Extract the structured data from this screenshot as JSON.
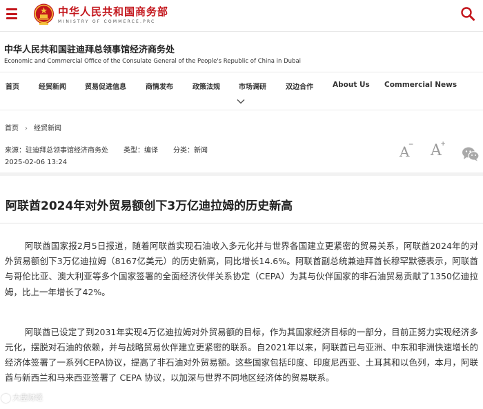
{
  "header": {
    "brand_cn": "中华人民共和国商务部",
    "brand_en": "MINISTRY OF COMMERCE.PRC"
  },
  "office": {
    "title_cn": "中华人民共和国驻迪拜总领事馆经济商务处",
    "title_en": "Economic and Commercial Office of the Consulate General of the People's Republic of China in Dubai"
  },
  "nav": {
    "items": [
      {
        "label": "首页"
      },
      {
        "label": "经贸新闻"
      },
      {
        "label": "贸易促进信息"
      },
      {
        "label": "商情发布"
      },
      {
        "label": "政策法规"
      },
      {
        "label": "市场调研"
      },
      {
        "label": "双边合作"
      },
      {
        "label": "About Us"
      },
      {
        "label": "Commercial News"
      }
    ]
  },
  "breadcrumb": {
    "home": "首页",
    "current": "经贸新闻"
  },
  "meta": {
    "source": "来源：驻迪拜总领事馆经济商务处",
    "type": "类型：编译",
    "category": "分类：新闻",
    "date": "2025-02-06 13:24",
    "font_small_label": "A",
    "font_large_label": "A",
    "font_small_sign": "−",
    "font_large_sign": "+"
  },
  "article": {
    "headline": "阿联酋2024年对外贸易额创下3万亿迪拉姆的历史新高",
    "paragraphs": [
      "阿联酋国家报2月5日报道，随着阿联酋实现石油收入多元化并与世界各国建立更紧密的贸易关系，阿联酋2024年的对外贸易额创下3万亿迪拉姆（8167亿美元）的历史新高，同比增长14.6%。阿联酋副总统兼迪拜酋长穆罕默德表示，阿联酋与哥伦比亚、澳大利亚等多个国家签署的全面经济伙伴关系协定（CEPA）为其与伙伴国家的非石油贸易贡献了1350亿迪拉姆，比上一年增长了42%。",
      "阿联酋已设定了到2031年实现4万亿迪拉姆对外贸易额的目标，作为其国家经济目标的一部分，目前正努力实现经济多元化，摆脱对石油的依赖，并与战略贸易伙伴建立更紧密的联系。自2021年以来，阿联酋已与亚洲、中东和非洲快速增长的经济体签署了一系列CEPA协议，提高了非石油对外贸易额。这些国家包括印度、印度尼西亚、土耳其和以色列，本月，阿联酋与新西兰和马来西亚签署了 CEPA 协议，以加深与世界不同地区经济体的贸易联系。"
    ]
  },
  "watermark": "大盘财经",
  "colors": {
    "brand_red": "#c3151b",
    "emblem_gold": "#f3c13a"
  }
}
